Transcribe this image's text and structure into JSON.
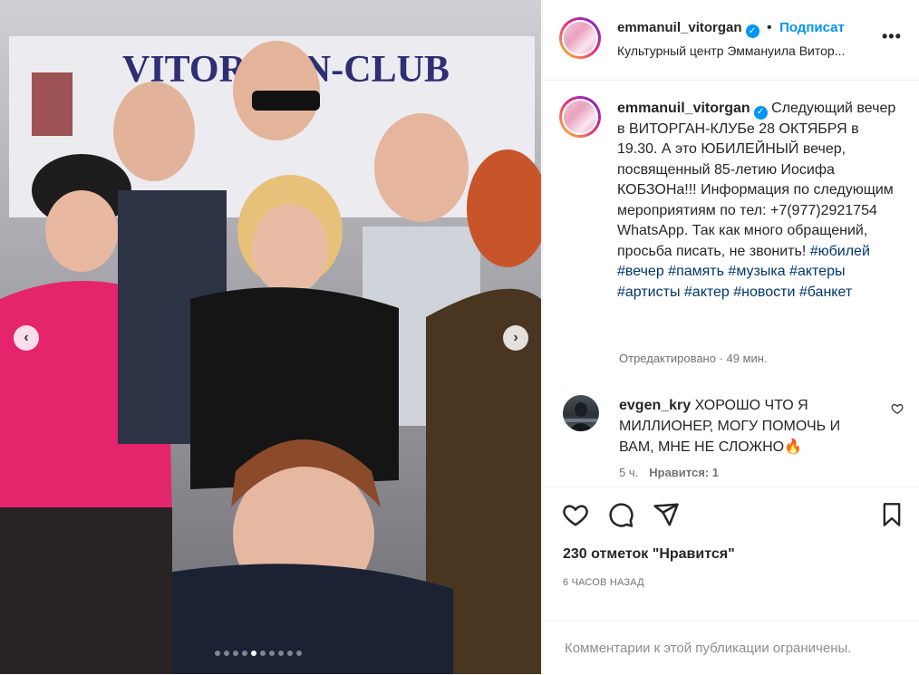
{
  "post": {
    "author": "emmanuil_vitorgan",
    "follow_label": "Подписат",
    "location": "Культурный центр Эммануила Витор...",
    "more_label": "•••"
  },
  "photo": {
    "banner_text": "VITORGAN-CLUB",
    "carousel_dots": 10,
    "active_dot": 4,
    "prev_icon": "chevron-left-icon",
    "next_icon": "chevron-right-icon"
  },
  "caption": {
    "username": "emmanuil_vitorgan",
    "text": "Следующий вечер в ВИТОРГАН-КЛУБе 28 ОКТЯБРЯ в 19.30. А это ЮБИЛЕЙНЫЙ вечер, посвященный 85-летию Иосифа КОБЗОНа!!! Информация по следующим мероприятиям по тел: +7(977)2921754 WhatsApp. Так как много обращений, просьба писать, не звонить!",
    "hashtags": [
      "#юбилей",
      "#вечер",
      "#память",
      "#музыка",
      "#актеры",
      "#артисты",
      "#актер",
      "#новости",
      "#банкет"
    ],
    "edited": "Отредактировано · 49 мин."
  },
  "comment": {
    "username": "evgen_kry",
    "text": "ХОРОШО ЧТО Я МИЛЛИОНЕР, МОГУ ПОМОЧЬ И ВАМ, МНЕ НЕ СЛОЖНО🔥",
    "age": "5 ч.",
    "likes": "Нравится: 1"
  },
  "stats": {
    "likes": "230 отметок \"Нравится\"",
    "posted": "6 ЧАСОВ НАЗАД",
    "comments_limited": "Комментарии к этой публикации ограничены."
  },
  "colors": {
    "accent": "#0095f6",
    "link": "#00376b",
    "muted": "#737373",
    "border": "#efefef"
  }
}
